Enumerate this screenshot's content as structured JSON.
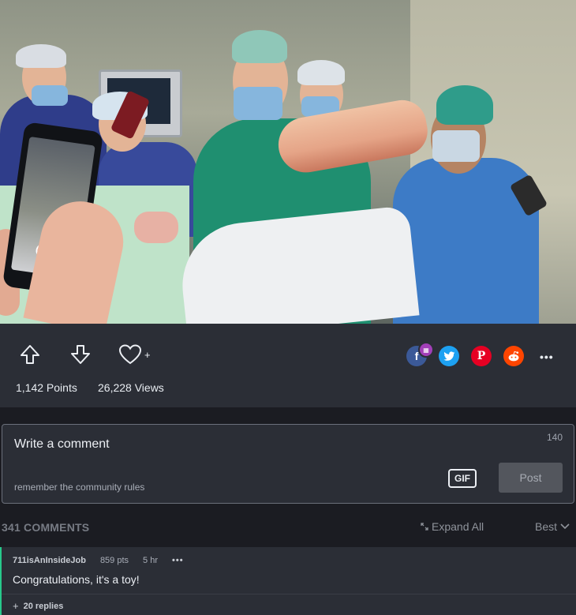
{
  "post": {
    "image_alt": "post-image"
  },
  "actions": {
    "points": "1,142 Points",
    "views": "26,228 Views",
    "favorite_plus": "+",
    "share": {
      "facebook": "f",
      "pinterest": "P",
      "more": "•••"
    },
    "colors": {
      "facebook": "#3b5998",
      "twitter": "#1da1f2",
      "pinterest": "#e60023",
      "reddit": "#ff4500"
    }
  },
  "comment_box": {
    "placeholder": "Write a comment",
    "char_count": "140",
    "rules_text": "remember the community rules",
    "gif_label": "GIF",
    "post_label": "Post"
  },
  "comments_header": {
    "count_label": "341 COMMENTS",
    "expand_label": "Expand All",
    "sort_label": "Best"
  },
  "comments": [
    {
      "author": "711isAnInsideJob",
      "points": "859 pts",
      "time": "5 hr",
      "options": "•••",
      "text": "Congratulations, it's a toy!",
      "replies_label": "20 replies",
      "replies_icon": "+",
      "accent_color": "#27c98b"
    }
  ]
}
